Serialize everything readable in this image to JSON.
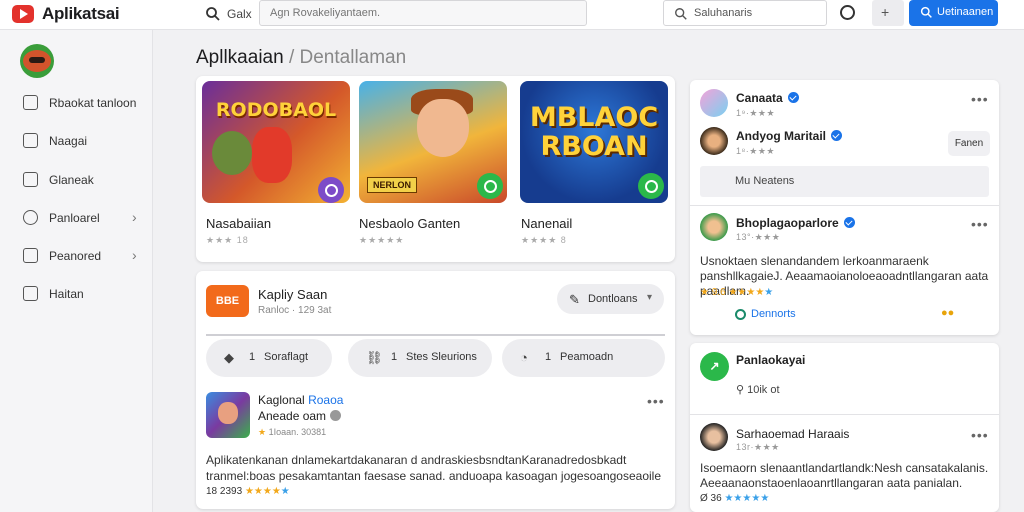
{
  "app": {
    "title": "Aplikatsai"
  },
  "topbar": {
    "search_label": "Galx",
    "search_placeholder": "Agn Rovakeliyantaem.",
    "search2_label": "Saluhanaris",
    "primary_label": "Uetinaanen",
    "filter_icon": "+"
  },
  "sidebar": {
    "items": [
      {
        "label": "Rbaokat tanloon",
        "icon": "home-icon",
        "chevron": false
      },
      {
        "label": "Naagai",
        "icon": "close-square-icon",
        "chevron": false
      },
      {
        "label": "Glaneak",
        "icon": "list-icon",
        "chevron": false
      },
      {
        "label": "Panloarel",
        "icon": "shield-icon",
        "chevron": true
      },
      {
        "label": "Peanored",
        "icon": "bookmark-icon",
        "chevron": true
      },
      {
        "label": "Haitan",
        "icon": "grid-icon",
        "chevron": false
      }
    ]
  },
  "main": {
    "title": "Apllkaaian",
    "title_sep": "/",
    "title_sub": "Dentallaman",
    "featured": [
      {
        "art_text": "RODOBAOL",
        "title": "Nasabaiian",
        "rating": "★★★ 18"
      },
      {
        "art_text": "",
        "badge_text": "NERLON",
        "title": "Nesbaolo Ganten",
        "rating": "★★★★★"
      },
      {
        "art_text": "MBLAOC RBOAN",
        "title": "Nanenail",
        "rating": "★★★★ 8"
      }
    ],
    "section": {
      "badge": "BBE",
      "title": "Kapliy Saan",
      "subtitle": "Ranloc · 129 3at",
      "sort_label": "Dontloans",
      "pills": [
        {
          "count": "1",
          "label": "Soraflagt"
        },
        {
          "count": "1",
          "label": "Stes Sleurions"
        },
        {
          "count": "1",
          "label": "Peamoadn"
        }
      ]
    },
    "post": {
      "name": "Kaglonal",
      "name_highlight": "Roaoa",
      "handle": "Aneade oam",
      "meta": "1Ioaan. 30381",
      "stars_icon": "★",
      "body_line1": "Aplikatenkanan dnlamekartdakanaran d andraskiesbsndtanKaranadredosbkadt",
      "body_line2": "tranmel:boas pesakamtantan faesase sanad. anduoapa kasoagan jogesoangoseaoile",
      "foot_count": "18 2393",
      "foot_stars": "★★★★",
      "foot_star_blue": "★"
    }
  },
  "right": {
    "users": [
      {
        "name": "Canaata",
        "meta": "1⁹·★★★"
      },
      {
        "name": "Andyog Maritail",
        "meta": "1⁸·★★★",
        "follow": "Fanen"
      }
    ],
    "more_label": "Mu Neatens",
    "review": {
      "name": "Bhoplagaoparlore",
      "meta": "13°·★★★",
      "body": "Usnoktaen slenandandem lerkoanmaraenk panshllkagaieJ. Aeaamaoianoloeaoadntllangaran aata paadlam.",
      "stars_count": "★ 9.6",
      "stars": "★★★★",
      "star_blue": "★",
      "link": "Dennorts",
      "emoji": "●●"
    },
    "popular": {
      "title": "Panlaokayai",
      "meta": "10ik ot",
      "user_name": "Sarhaoemad Haraais",
      "user_meta": "13r·★★★",
      "body": "Isoemaorn slenaantlandartlandk:Nesh cansatakalanis. Aeeaanaonstaoenlaoanrtllangaran aata panialan.",
      "foot_count": "Ø 36",
      "foot_stars": "★★★★★"
    }
  },
  "colors": {
    "accent": "#1a73e8",
    "logo": "#e3322c",
    "orange": "#f26a1b",
    "green": "#2bb84a"
  }
}
